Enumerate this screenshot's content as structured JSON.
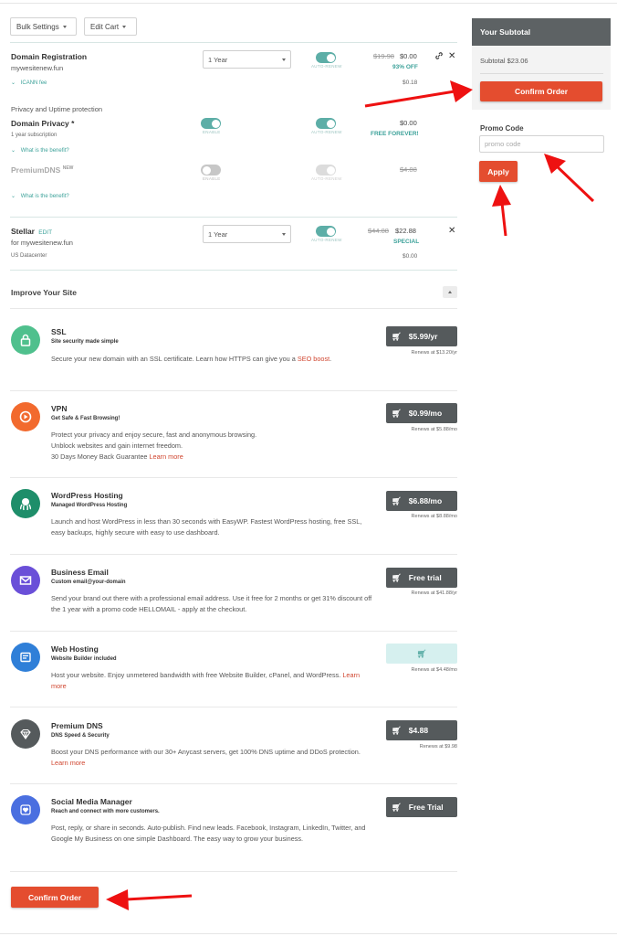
{
  "toolbar": {
    "bulk_settings": "Bulk Settings",
    "edit_cart": "Edit Cart"
  },
  "domain": {
    "title": "Domain Registration",
    "domain_name": "mywesitenew.fun",
    "term": "1 Year",
    "auto_renew": "AUTO-RENEW",
    "old_price": "$19.98",
    "price": "$0.00",
    "discount": "93% OFF",
    "icann_label": "ICANN fee",
    "icann_price": "$0.18"
  },
  "privacy": {
    "section_title": "Privacy and Uptime protection",
    "title": "Domain Privacy *",
    "subtitle": "1 year subscription",
    "enable": "ENABLE",
    "auto_renew": "AUTO-RENEW",
    "price": "$0.00",
    "promo": "FREE FOREVER!",
    "benefit": "What is the benefit?"
  },
  "premium_dns_line": {
    "title": "PremiumDNS",
    "badge": "NEW",
    "enable": "ENABLE",
    "auto_renew": "AUTO-RENEW",
    "price": "$4.88",
    "benefit": "What is the benefit?"
  },
  "stellar": {
    "title": "Stellar",
    "edit": "EDIT",
    "for_text": "for mywesitenew.fun",
    "datacenter": "US Datacenter",
    "term": "1 Year",
    "auto_renew": "AUTO-RENEW",
    "old_price": "$44.88",
    "price": "$22.88",
    "special": "SPECIAL",
    "datacenter_price": "$0.00"
  },
  "improve": {
    "title": "Improve Your Site",
    "products": [
      {
        "name": "SSL",
        "tagline": "Site security made simple",
        "desc": "Secure your new domain with an SSL certificate. Learn how HTTPS can give you a ",
        "link": "SEO boost",
        "desc_after": ".",
        "button": "$5.99/yr",
        "renews": "Renews at $13.20/yr",
        "color": "#4fc08d"
      },
      {
        "name": "VPN",
        "tagline": "Get Safe & Fast Browsing!",
        "desc": "Protect your privacy and enjoy secure, fast and anonymous browsing.\nUnblock websites and gain internet freedom.\n30 Days Money Back Guarantee ",
        "link": "Learn more",
        "desc_after": "",
        "button": "$0.99/mo",
        "renews": "Renews at $5.88/mo",
        "color": "#f26a2e"
      },
      {
        "name": "WordPress Hosting",
        "tagline": "Managed WordPress Hosting",
        "desc": "Launch and host WordPress in less than 30 seconds with EasyWP. Fastest WordPress hosting, free SSL, easy backups, highly secure with easy to use dashboard.",
        "link": "",
        "desc_after": "",
        "button": "$6.88/mo",
        "renews": "Renews at $8.88/mo",
        "color": "#1e8e6a"
      },
      {
        "name": "Business Email",
        "tagline": "Custom email@your-domain",
        "desc": "Send your brand out there with a professional email address. Use it free for 2 months or get 31% discount off the 1 year with a promo code HELLOMAIL - apply at the checkout.",
        "link": "",
        "desc_after": "",
        "button": "Free trial",
        "renews": "Renews at $41.88/yr",
        "color": "#6a4fd8"
      },
      {
        "name": "Web Hosting",
        "tagline": "Website Builder included",
        "desc": "Host your website. Enjoy unmetered bandwidth with free Website Builder, cPanel, and WordPress. ",
        "link": "Learn more",
        "desc_after": "",
        "button": "",
        "renews": "Renews at $4.48/mo",
        "color": "#2f7fd8"
      },
      {
        "name": "Premium DNS",
        "tagline": "DNS Speed & Security",
        "desc": "Boost your DNS performance with our 30+ Anycast servers, get 100% DNS uptime and DDoS protection. ",
        "link": "Learn more",
        "desc_after": "",
        "button": "$4.88",
        "renews": "Renews at $9.98",
        "color": "#555a5c"
      },
      {
        "name": "Social Media Manager",
        "tagline": "Reach and connect with more customers.",
        "desc": "Post, reply, or share in seconds. Auto-publish. Find new leads. Facebook, Instagram, LinkedIn, Twitter, and Google My Business on one simple Dashboard. The easy way to grow your business.",
        "link": "",
        "desc_after": "",
        "button": "Free Trial",
        "renews": "",
        "color": "#4a6fe0"
      }
    ]
  },
  "sidebar": {
    "heading": "Your Subtotal",
    "subtotal": "Subtotal $23.06",
    "confirm": "Confirm Order",
    "promo_label": "Promo Code",
    "promo_placeholder": "promo code",
    "apply": "Apply"
  },
  "footer": {
    "confirm": "Confirm Order"
  },
  "colors": {
    "accent": "#e44d2f",
    "teal": "#3da29a",
    "dark": "#555a5c",
    "annotation_arrow": "#ee1111"
  }
}
